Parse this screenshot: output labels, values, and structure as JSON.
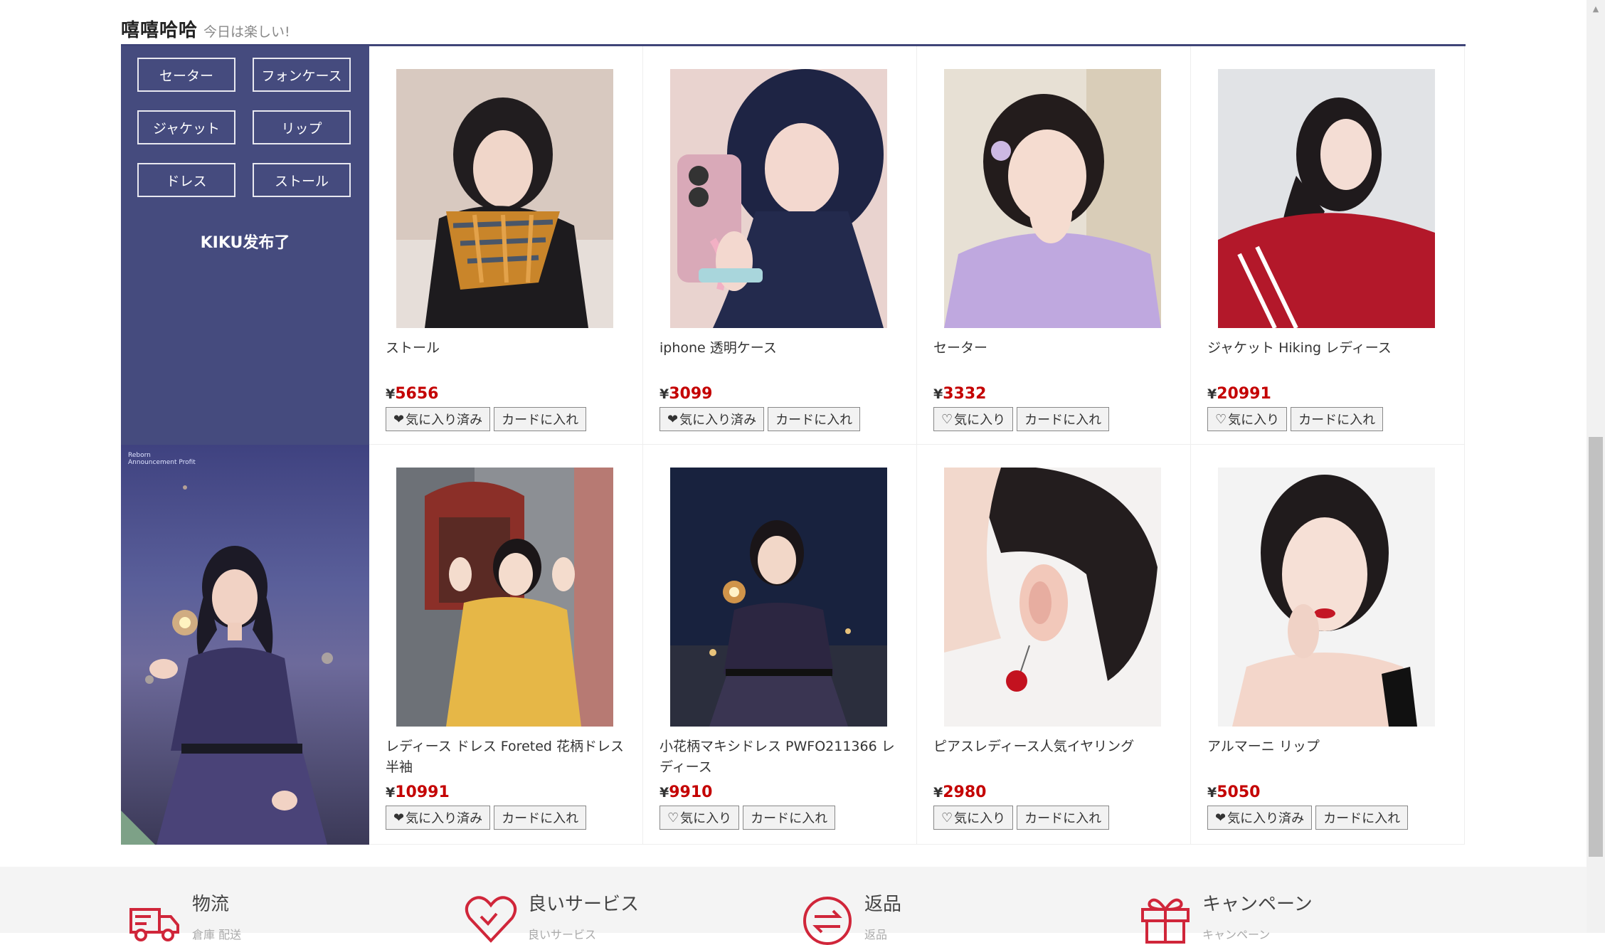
{
  "section": {
    "title": "嘻嘻哈哈",
    "subtitle": "今日は楽しい!"
  },
  "sidebar": {
    "categories": [
      "セーター",
      "フォンケース",
      "ジャケット",
      "リップ",
      "ドレス",
      "ストール"
    ],
    "announcement": "KIKU发布了",
    "photo_caption_line1": "Reborn",
    "photo_caption_line2": "Announcement Profit"
  },
  "products": [
    {
      "name": "ストール",
      "currency": "¥",
      "price": "5656",
      "favorite": true,
      "fav_label": "気に入り済み",
      "cart_label": "カードに入れ",
      "heart": "❤"
    },
    {
      "name": "iphone 透明ケース",
      "currency": "¥",
      "price": "3099",
      "favorite": true,
      "fav_label": "気に入り済み",
      "cart_label": "カードに入れ",
      "heart": "❤"
    },
    {
      "name": "セーター",
      "currency": "¥",
      "price": "3332",
      "favorite": false,
      "fav_label": "気に入り",
      "cart_label": "カードに入れ",
      "heart": "♡"
    },
    {
      "name": "ジャケット Hiking レディース",
      "currency": "¥",
      "price": "20991",
      "favorite": false,
      "fav_label": "気に入り",
      "cart_label": "カードに入れ",
      "heart": "♡"
    },
    {
      "name": "レディース ドレス Foreted 花柄ドレス 半袖",
      "currency": "¥",
      "price": "10991",
      "favorite": true,
      "fav_label": "気に入り済み",
      "cart_label": "カードに入れ",
      "heart": "❤"
    },
    {
      "name": "小花柄マキシドレス PWFO211366 レディース",
      "currency": "¥",
      "price": "9910",
      "favorite": false,
      "fav_label": "気に入り",
      "cart_label": "カードに入れ",
      "heart": "♡"
    },
    {
      "name": "ピアスレディース人気イヤリング",
      "currency": "¥",
      "price": "2980",
      "favorite": false,
      "fav_label": "気に入り",
      "cart_label": "カードに入れ",
      "heart": "♡"
    },
    {
      "name": "アルマーニ リップ",
      "currency": "¥",
      "price": "5050",
      "favorite": true,
      "fav_label": "気に入り済み",
      "cart_label": "カードに入れ",
      "heart": "❤"
    }
  ],
  "features": [
    {
      "label": "物流",
      "sub": "倉庫 配送",
      "icon": "truck-icon"
    },
    {
      "label": "良いサービス",
      "sub": "良いサービス",
      "icon": "heart-icon"
    },
    {
      "label": "返品",
      "sub": "返品",
      "icon": "return-arrows-icon"
    },
    {
      "label": "キャンペーン",
      "sub": "キャンペーン",
      "icon": "gift-icon"
    }
  ],
  "colors": {
    "accent": "#454b7e",
    "price": "#c40000",
    "icon_red": "#d0263a"
  }
}
